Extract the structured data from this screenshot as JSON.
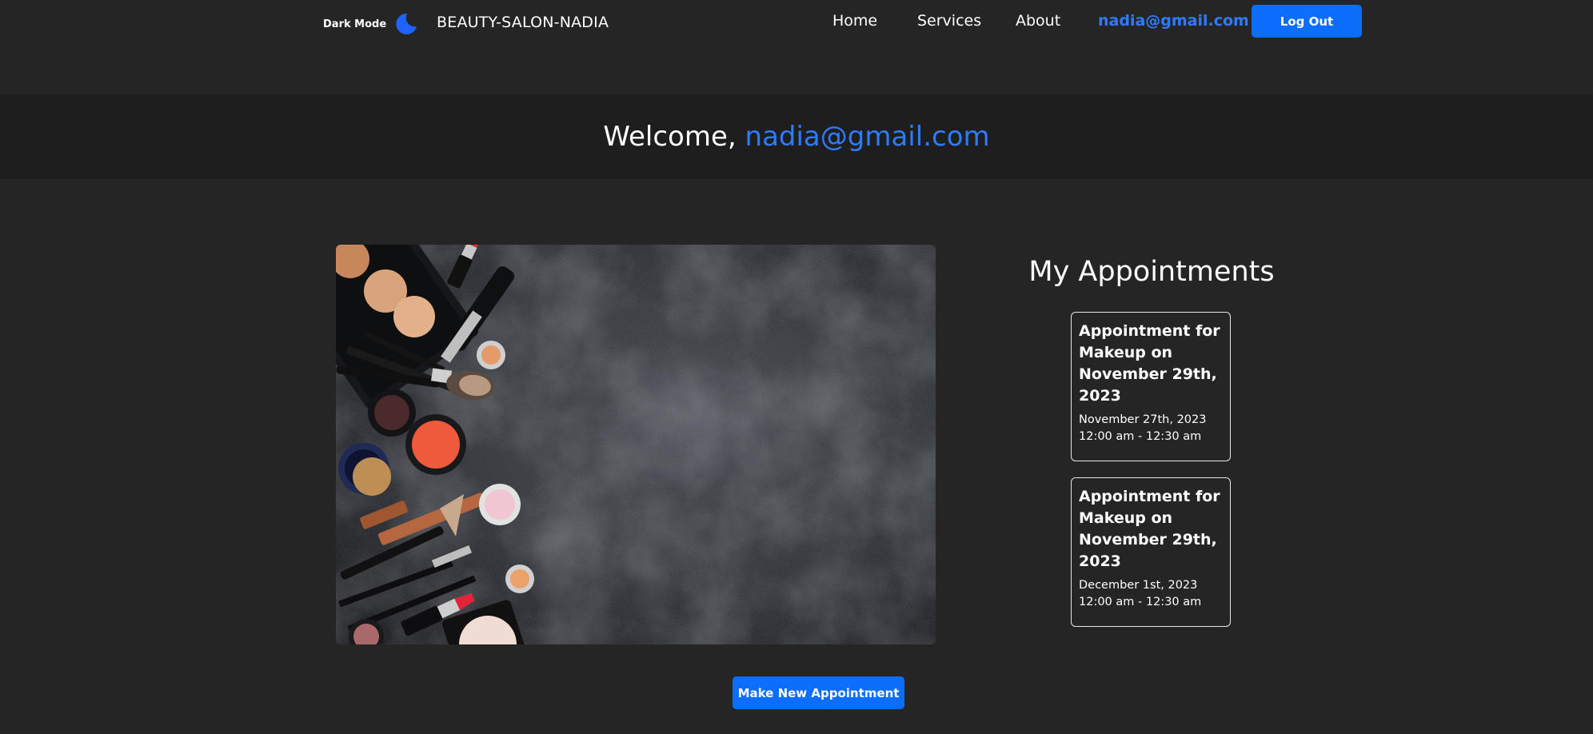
{
  "nav": {
    "dark_mode_label": "Dark Mode",
    "theme_icon": "moon-icon",
    "brand": "BEAUTY-SALON-NADIA",
    "links": [
      "Home",
      "Services",
      "About"
    ],
    "user_email": "nadia@gmail.com",
    "logout_label": "Log Out"
  },
  "welcome": {
    "prefix": "Welcome,",
    "email": "nadia@gmail.com"
  },
  "appointments": {
    "heading": "My Appointments",
    "items": [
      {
        "title": "Appointment for Makeup on November 29th, 2023",
        "date": "November 27th, 2023 12:00 am - 12:30 am"
      },
      {
        "title": "Appointment for Makeup on November 29th, 2023",
        "date": "December 1st, 2023 12:00 am - 12:30 am"
      }
    ]
  },
  "make_appointment_label": "Make New Appointment",
  "colors": {
    "background": "#252526",
    "band": "#1e1e1e",
    "accent": "#0d6efd",
    "link_accent": "#2f7bff"
  }
}
